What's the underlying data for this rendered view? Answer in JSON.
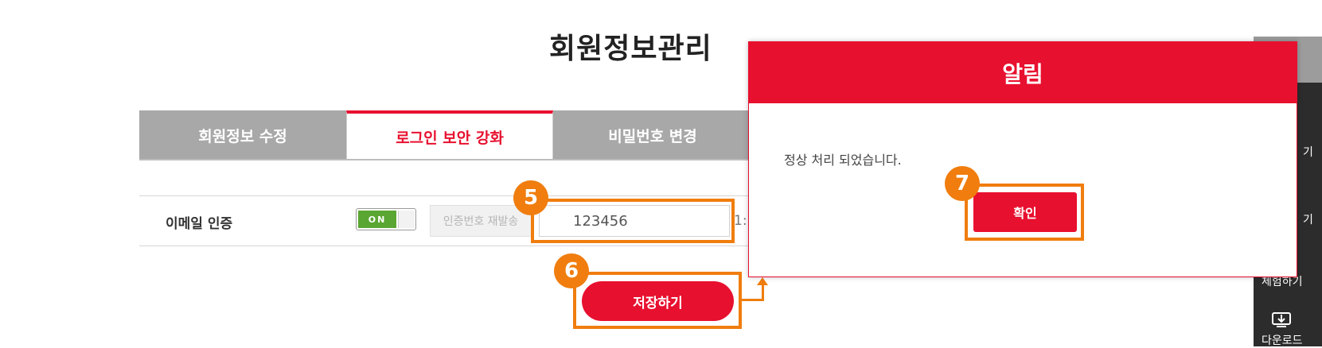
{
  "page": {
    "title": "회원정보관리"
  },
  "tabs": [
    {
      "label": "회원정보 수정",
      "active": false
    },
    {
      "label": "로그인 보안 강화",
      "active": true
    },
    {
      "label": "비밀번호 변경",
      "active": false
    }
  ],
  "email_row": {
    "label": "이메일 인증",
    "toggle": "ON",
    "resend_label": "인증번호 재발송",
    "code_value": "123456",
    "timer_partial": "1:"
  },
  "save_label": "저장하기",
  "annotations": {
    "step5": "5",
    "step6": "6",
    "step7": "7"
  },
  "modal": {
    "title": "알림",
    "message": "정상 처리 되었습니다.",
    "confirm_label": "확인"
  },
  "sidebar": {
    "items": [
      "기",
      "기",
      "체험하기",
      "다운로드"
    ],
    "download_icon": "download-icon"
  },
  "colors": {
    "accent": "#e8102f",
    "highlight": "#f07d0e",
    "toggle_on": "#5aa632",
    "tab_inactive": "#a8a8a8"
  }
}
